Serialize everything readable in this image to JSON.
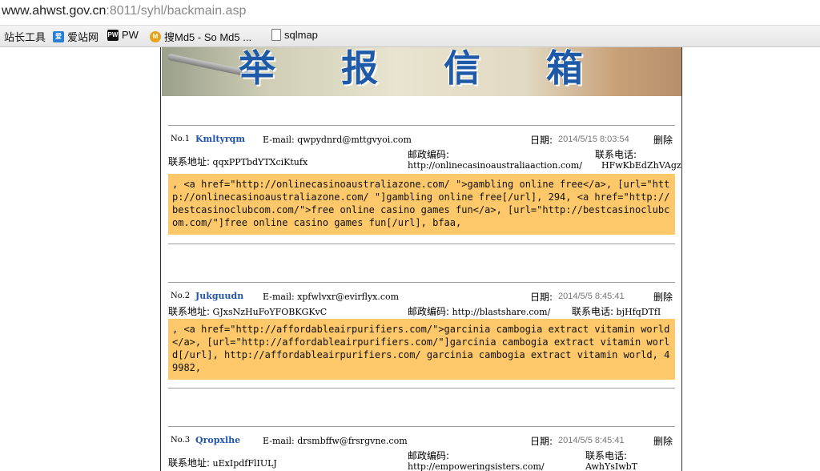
{
  "browser": {
    "url_main": "www.ahwst.gov.cn",
    "url_rest": ":8011/syhl/backmain.asp",
    "bookmarks": [
      {
        "label": "站长工具",
        "icon": "none"
      },
      {
        "label": "爱站网",
        "icon": "aizhan-icon"
      },
      {
        "label": "PW",
        "icon": "pw-icon"
      },
      {
        "label": "搜Md5 - So Md5 ...",
        "icon": "md5-icon"
      },
      {
        "label": "sqlmap",
        "icon": "document-icon"
      }
    ]
  },
  "banner": {
    "chars": [
      "举",
      "报",
      "信",
      "箱"
    ]
  },
  "labels": {
    "email": "E-mail:",
    "date": "日期:",
    "delete": "删除",
    "address": "联系地址:",
    "postcode": "邮政编码:",
    "phone": "联系电话:"
  },
  "entries": [
    {
      "no": "No.1",
      "name": "Kmltyrqm",
      "email": "qwpydnrd@mttgvyoi.com",
      "date": "2014/5/15 8:03:54",
      "address": "qqxPPTbdYTXciKtufx",
      "postcode": "http://onlinecasinoaustraliaaction.com/",
      "phone": "HFwKbEdZhVAgzqi",
      "message": ", <a href=\"http://onlinecasinoaustraliazone.com/ \">gambling online free</a>, [url=\"http://onlinecasinoaustraliazone.com/ \"]gambling online free[/url],  294, <a href=\"http://bestcasinoclubcom.com/\">free online casino games fun</a>, [url=\"http://bestcasinoclubcom.com/\"]free online casino games fun[/url],  bfaa,"
    },
    {
      "no": "No.2",
      "name": "Jukguudn",
      "email": "xpfwlvxr@evirflyx.com",
      "date": "2014/5/5 8:45:41",
      "address": "GJxsNzHuFoYFOBKGKvC",
      "postcode": "http://blastshare.com/",
      "phone": "bjHfqDTfI",
      "message": ", <a href=\"http://affordableairpurifiers.com/\">garcinia cambogia extract vitamin world</a>, [url=\"http://affordableairpurifiers.com/\"]garcinia cambogia extract vitamin world[/url], http://affordableairpurifiers.com/ garcinia cambogia extract vitamin world,  49982,"
    },
    {
      "no": "No.3",
      "name": "Qropxlhe",
      "email": "drsmbffw@frsrgvne.com",
      "date": "2014/5/5 8:45:41",
      "address": "uExIpdfFlIULJ",
      "postcode": "http://empoweringsisters.com/",
      "phone": "AwhYsIwbT"
    }
  ]
}
